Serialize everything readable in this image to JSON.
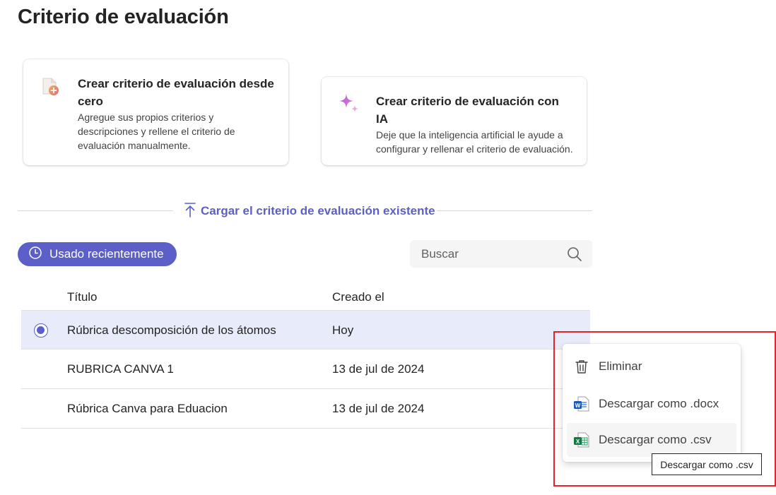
{
  "page": {
    "title": "Criterio de evaluación"
  },
  "cards": {
    "scratch": {
      "title": "Crear criterio de evaluación desde cero",
      "description": "Agregue sus propios criterios y descripciones y rellene el criterio de evaluación manualmente.",
      "icon": "document-plus-icon"
    },
    "ai": {
      "title": "Crear criterio de evaluación con IA",
      "description": "Deje que la inteligencia artificial le ayude a configurar y rellenar el criterio de evaluación.",
      "icon": "sparkle-icon"
    }
  },
  "upload": {
    "label": "Cargar el criterio de evaluación existente",
    "icon": "arrow-upload-icon"
  },
  "filter": {
    "recent_label": "Usado recientemente",
    "icon": "clock-icon"
  },
  "search": {
    "placeholder": "Buscar",
    "icon": "search-icon"
  },
  "table": {
    "columns": [
      "Título",
      "Creado el"
    ],
    "rows": [
      {
        "title": "Rúbrica descomposición de los átomos",
        "created": "Hoy",
        "selected": true
      },
      {
        "title": "RUBRICA CANVA 1",
        "created": "13 de jul de 2024",
        "selected": false
      },
      {
        "title": "Rúbrica Canva para Eduacion",
        "created": "13 de jul de 2024",
        "selected": false
      }
    ]
  },
  "context_menu": {
    "items": [
      {
        "label": "Eliminar",
        "icon": "trash-icon"
      },
      {
        "label": "Descargar como .docx",
        "icon": "word-icon"
      },
      {
        "label": "Descargar como .csv",
        "icon": "excel-icon"
      }
    ],
    "tooltip": "Descargar como .csv"
  },
  "colors": {
    "accent": "#5b5fc7",
    "selected_row": "#e8ebfa",
    "highlight": "#e4232a"
  }
}
